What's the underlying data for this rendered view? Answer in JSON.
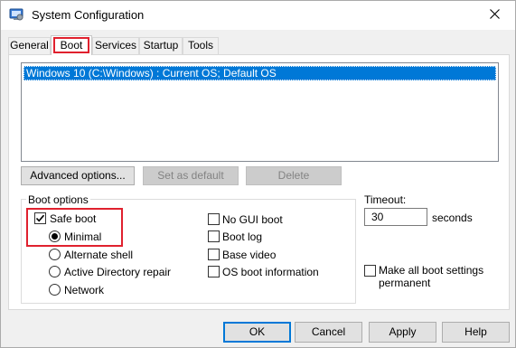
{
  "window": {
    "title": "System Configuration",
    "app_icon": "msconfig-icon",
    "close_icon": "close-icon"
  },
  "tabs": [
    {
      "label": "General"
    },
    {
      "label": "Boot",
      "active": true
    },
    {
      "label": "Services"
    },
    {
      "label": "Startup"
    },
    {
      "label": "Tools"
    }
  ],
  "os_list": {
    "entries": [
      "Windows 10 (C:\\Windows) : Current OS; Default OS"
    ],
    "selected_index": 0
  },
  "buttons": {
    "advanced": "Advanced options...",
    "set_default": "Set as default",
    "delete": "Delete"
  },
  "boot_options": {
    "label": "Boot options",
    "safe_boot": {
      "label": "Safe boot",
      "checked": true
    },
    "modes": [
      {
        "label": "Minimal",
        "selected": true
      },
      {
        "label": "Alternate shell",
        "selected": false
      },
      {
        "label": "Active Directory repair",
        "selected": false
      },
      {
        "label": "Network",
        "selected": false
      }
    ],
    "right": [
      {
        "label": "No GUI boot",
        "checked": false
      },
      {
        "label": "Boot log",
        "checked": false
      },
      {
        "label": "Base video",
        "checked": false
      },
      {
        "label": "OS boot information",
        "checked": false
      }
    ]
  },
  "timeout": {
    "label": "Timeout:",
    "value": "30",
    "unit": "seconds"
  },
  "make_permanent": {
    "line1": "Make all boot settings",
    "line2": "permanent",
    "checked": false
  },
  "footer": {
    "ok": "OK",
    "cancel": "Cancel",
    "apply": "Apply",
    "help": "Help"
  },
  "colors": {
    "highlight": "#0078d7",
    "annotation_red": "#e0212e"
  }
}
